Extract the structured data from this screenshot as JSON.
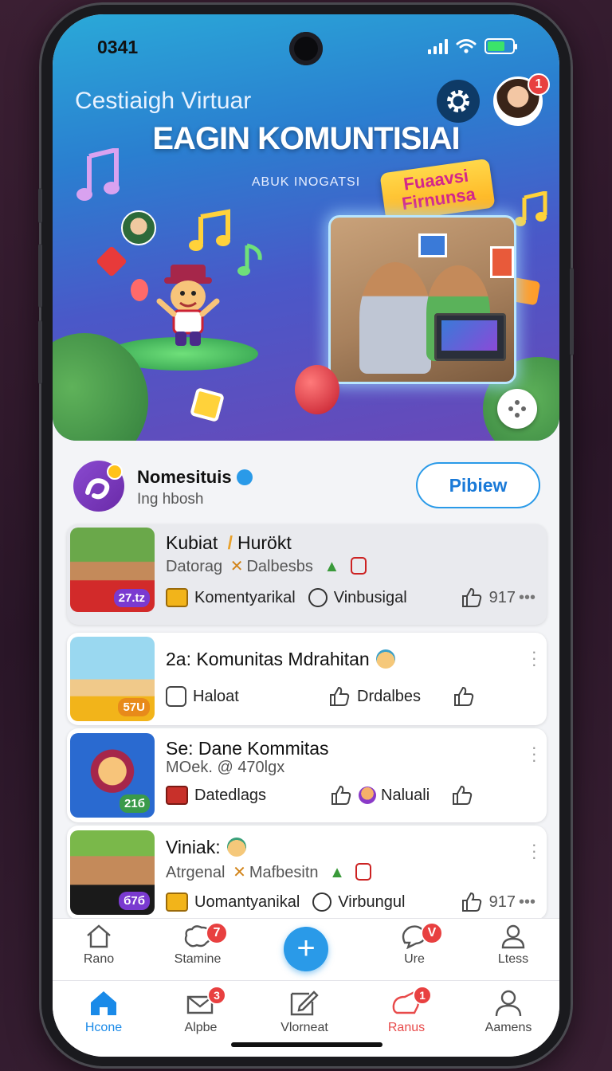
{
  "status": {
    "time": "0341"
  },
  "hero": {
    "title": "Cestiaigh Virtuar",
    "heading": "EAGIN KOMUNTISIAI",
    "subheading": "ABUK INOGATSI",
    "promo_line1": "Fuaavsi",
    "promo_line2": "Firnunsa",
    "notification_count": "1"
  },
  "profile": {
    "name": "Nomesituis",
    "subtitle": "Ing hbosh",
    "preview_label": "Pibiew"
  },
  "posts": [
    {
      "title": "Kubiat",
      "title_suffix": "Hurökt",
      "sub_left": "Datorag",
      "sub_right": "Dalbesbs",
      "thumb_count": "27.tz",
      "action1": "Komentyarikal",
      "action2": "Vinbusigal",
      "likes": "917"
    },
    {
      "title": "2a: Komunitas Mdrahitan",
      "thumb_count": "57U",
      "action1": "Haloat",
      "action2": "Drdalbes"
    },
    {
      "title": "Se: Dane Kommitas",
      "subtitle": "MOek. @ 470lgx",
      "thumb_count": "21б",
      "action1": "Datedlags",
      "action2": "Naluali"
    },
    {
      "title": "Viniak:",
      "sub_left": "Atrgenal",
      "sub_right": "Mafbesitn",
      "thumb_count": "б7б",
      "action1": "Uomantyanikal",
      "action2": "Virbungul",
      "likes": "917"
    }
  ],
  "nav_top": [
    {
      "label": "Rano"
    },
    {
      "label": "Stamine",
      "badge": "7"
    },
    {
      "label": "Ure",
      "badge": "V"
    },
    {
      "label": "Ltess"
    }
  ],
  "nav_bottom": [
    {
      "label": "Hcone"
    },
    {
      "label": "Alpbe",
      "badge": "3"
    },
    {
      "label": "Vlorneat"
    },
    {
      "label": "Ranus",
      "badge": "1"
    },
    {
      "label": "Aamens"
    }
  ],
  "colors": {
    "accent": "#2a9ae8",
    "badge": "#e84040",
    "purple": "#7a3ad0",
    "active_nav": "#1a8ae8",
    "alert_nav": "#e84a4a"
  }
}
